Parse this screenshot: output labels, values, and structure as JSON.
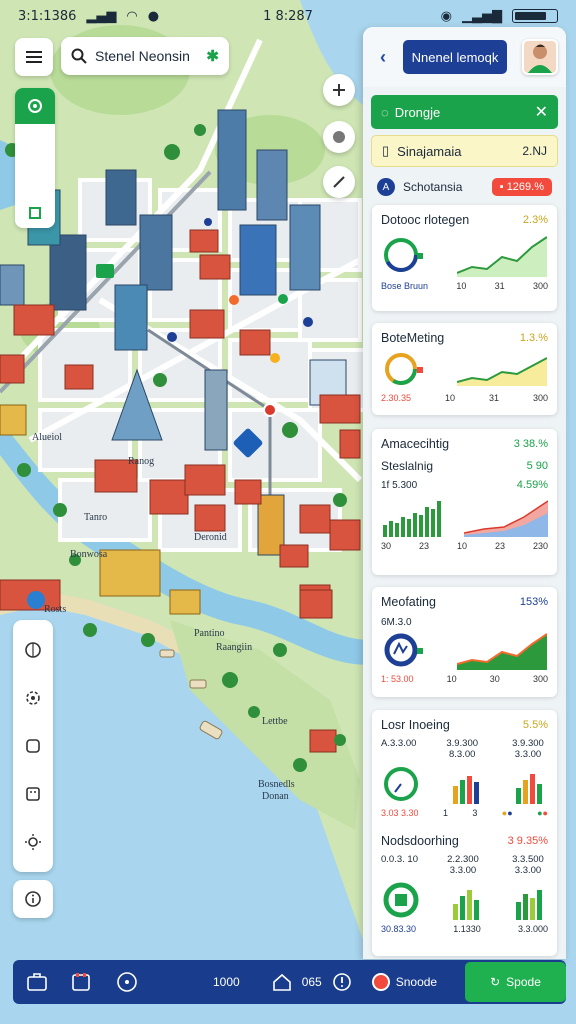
{
  "status_bar": {
    "left_text": "3:1:1386",
    "center_text": "1 8:287"
  },
  "search": {
    "value": "Stenel Neonsin",
    "mark": "✱"
  },
  "map_labels": [
    "Alueiol",
    "Ranog",
    "Tanro",
    "Bonwosa",
    "Deronid",
    "Pantino",
    "Raangiin",
    "Lettbe",
    "Bosnedls",
    "Donan",
    "Rosts"
  ],
  "panel": {
    "header_button": "Nnenel lemoqk",
    "green_bar": {
      "label": "Drongje",
      "close": "✕"
    },
    "yellow_bar": {
      "label": "Sinajamaia",
      "value": "2.NJ"
    },
    "blue_row": {
      "label": "Schotansia",
      "pill": "▪ 1269.%"
    },
    "cards": [
      {
        "title": "Dotooc rlotegen",
        "pct": "2.3%",
        "pct_color": "#c9a51e",
        "caption": "Bose Bruun",
        "ticks": [
          "10",
          "31",
          "300"
        ]
      },
      {
        "title": "BoteMeting",
        "pct": "1.3.%",
        "pct_color": "#c9a51e",
        "caption": "2.30.35",
        "ticks": [
          "10",
          "31",
          "300"
        ]
      },
      {
        "title": "Amacecihtig",
        "pct": "3 38.%",
        "pct_color": "#1aa34a",
        "sub_title": "Steslalnig",
        "sub_pct": "5 90",
        "sub_value": "1f 5.300",
        "sub_value_pct": "4.59%",
        "ticks": [
          "30",
          "23",
          "10",
          "23",
          "230"
        ]
      },
      {
        "title": "Meofating",
        "pct": "153%",
        "pct_color": "#1d3f95",
        "sub_value": "6M.3.0",
        "caption": "1: 53.00",
        "ticks": [
          "10",
          "30",
          "300"
        ]
      },
      {
        "title": "Losr Inoeing",
        "pct": "5.5%",
        "pct_color": "#c9a51e",
        "col1_head": "A.3.3.00",
        "col2_head": "3.9.300 8.3.00",
        "col3_head": "3.9.300 3.3.00",
        "caption": "3.03 3.30",
        "ticks": [
          "1",
          "3"
        ]
      },
      {
        "title": "Nodsdoorhing",
        "pct": "3 9.35%",
        "pct_color": "#f24a3c",
        "col1_head": "0.0.3. 10",
        "col2_head": "2.2.300 3.3.00",
        "col3_head": "3.3.500 3.3.00",
        "caption": "30.83.30",
        "col2_foot": "1.1330",
        "col3_foot": "3.3.000"
      }
    ]
  },
  "bottom_bar": {
    "label": "1000",
    "status": "065",
    "search_label": "Snoode",
    "action_label": "Spode"
  },
  "colors": {
    "primary_navy": "#193c8c",
    "green": "#1aa34a",
    "red": "#f24a3c",
    "yellow_bar": "#fbf6c8",
    "water": "#a9d6ee",
    "land": "#cfe6b4"
  }
}
